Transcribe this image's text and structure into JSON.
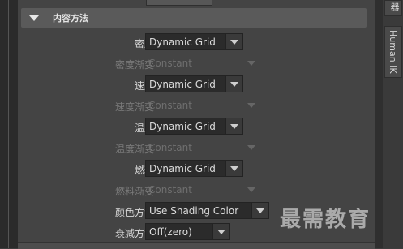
{
  "section": {
    "title": "内容方法"
  },
  "rows": [
    {
      "label": "密度",
      "value": "Dynamic Grid",
      "disabled": false
    },
    {
      "label": "密度渐变",
      "value": "Constant",
      "disabled": true
    },
    {
      "label": "速度",
      "value": "Dynamic Grid",
      "disabled": false
    },
    {
      "label": "速度渐变",
      "value": "Constant",
      "disabled": true
    },
    {
      "label": "温度",
      "value": "Dynamic Grid",
      "disabled": false
    },
    {
      "label": "温度渐变",
      "value": "Constant",
      "disabled": true
    },
    {
      "label": "燃料",
      "value": "Dynamic Grid",
      "disabled": false
    },
    {
      "label": "燃料渐变",
      "value": "Constant",
      "disabled": true
    },
    {
      "label": "颜色方法",
      "value": "Use Shading Color",
      "disabled": false
    },
    {
      "label": "衰减方法",
      "value": "Off(zero)",
      "disabled": false
    }
  ],
  "right_tabs": [
    {
      "label": "器"
    },
    {
      "label": "Human IK"
    }
  ],
  "watermark": "最需教育"
}
